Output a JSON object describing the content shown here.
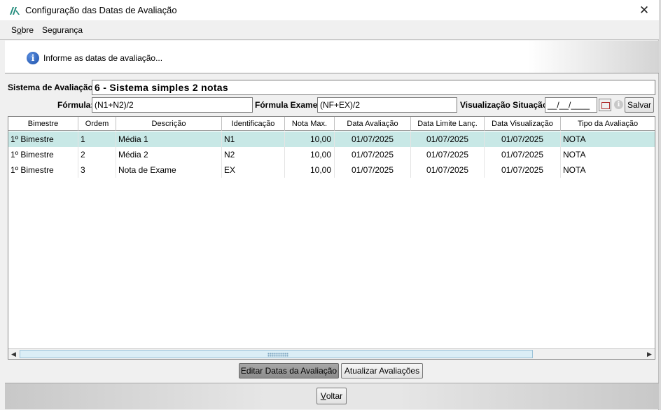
{
  "window": {
    "title": "Configuração das Datas de Avaliação",
    "close_glyph": "✕"
  },
  "menu": {
    "items": [
      {
        "label": "Sobre",
        "mnemonic": "o"
      },
      {
        "label": "Segurança"
      }
    ]
  },
  "info": {
    "icon": "info-icon",
    "text": "Informe as datas de avaliação..."
  },
  "sistema": {
    "label": "Sistema de Avaliação:",
    "value": "6 - Sistema simples 2 notas"
  },
  "formula": {
    "label": "Fórmula:",
    "value": "(N1+N2)/2",
    "exame_label": "Fórmula Exame:",
    "exame_value": "(NF+EX)/2",
    "visualizacao_label": "Visualização Situação:",
    "visualizacao_value": "__/__/____",
    "save_label": "Salvar"
  },
  "grid": {
    "columns": [
      "Bimestre",
      "Ordem",
      "Descrição",
      "Identificação",
      "Nota Max.",
      "Data Avaliação",
      "Data Limite Lanç.",
      "Data Visualização",
      "Tipo da Avaliação"
    ],
    "rows": [
      [
        "1º Bimestre",
        "1",
        "Média 1",
        "N1",
        "10,00",
        "01/07/2025",
        "01/07/2025",
        "01/07/2025",
        "NOTA"
      ],
      [
        "1º Bimestre",
        "2",
        "Média 2",
        "N2",
        "10,00",
        "01/07/2025",
        "01/07/2025",
        "01/07/2025",
        "NOTA"
      ],
      [
        "1º Bimestre",
        "3",
        "Nota de Exame",
        "EX",
        "10,00",
        "01/07/2025",
        "01/07/2025",
        "01/07/2025",
        "NOTA"
      ]
    ],
    "selected_row": 0,
    "selection_color": "#c8e8e6"
  },
  "actions": {
    "edit_dates": "Editar Datas da Avaliação",
    "update": "Atualizar Avaliações",
    "back": "Voltar"
  }
}
